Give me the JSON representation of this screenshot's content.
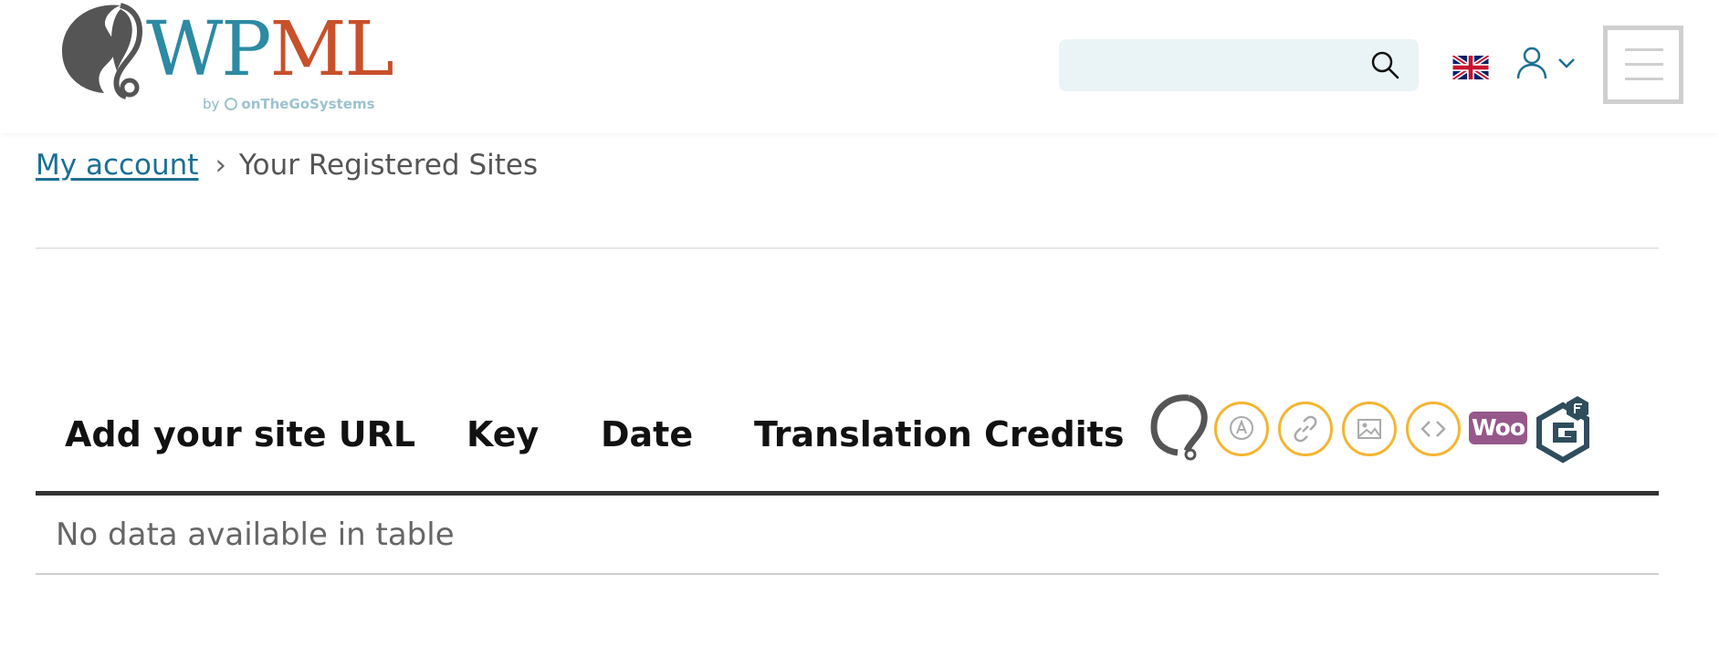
{
  "header": {
    "logo": {
      "text_wp": "WP",
      "text_ml": "ML",
      "by": "by",
      "company": "onTheGoSystems"
    },
    "search": {
      "placeholder": ""
    },
    "language": "English (UK) flag",
    "icons": {
      "search": "search-icon",
      "flag": "uk-flag-icon",
      "user": "user-icon",
      "chevron": "chevron-down-icon",
      "menu": "hamburger-menu-icon"
    }
  },
  "breadcrumb": {
    "link": "My account",
    "separator": "›",
    "current": "Your Registered Sites"
  },
  "table": {
    "columns": [
      "Add your site URL",
      "Key",
      "Date",
      "Translation Credits"
    ],
    "addon_icons": [
      "wpml-icon",
      "string-translation-icon",
      "link-icon",
      "media-icon",
      "code-icon",
      "woocommerce-icon",
      "gravity-forms-icon"
    ],
    "woo_label": "Woo",
    "empty_message": "No data available in table"
  },
  "colors": {
    "brand_blue": "#2c8aa3",
    "brand_orange": "#c8502a",
    "link": "#1b6f93",
    "addon_ring": "#f2b632",
    "woo": "#96588a"
  }
}
